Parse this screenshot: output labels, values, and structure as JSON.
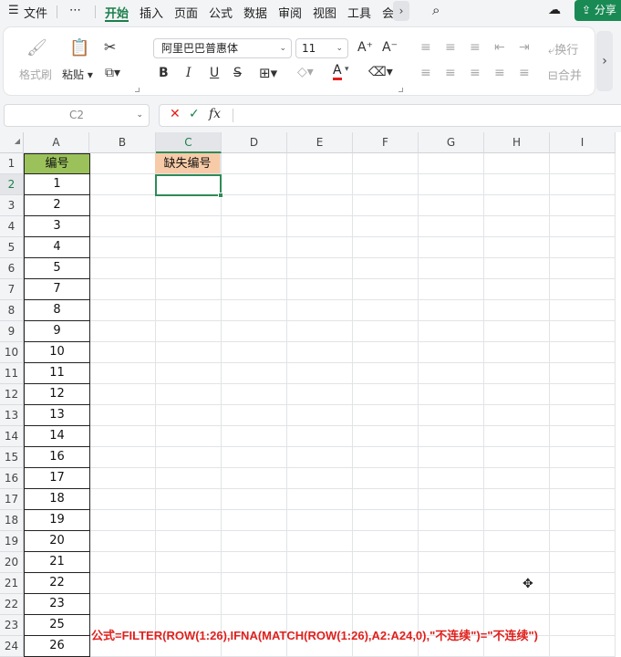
{
  "menu": {
    "file_icon": "hamburger-icon",
    "file": "文件",
    "more": "⋯",
    "tabs": [
      "开始",
      "插入",
      "页面",
      "公式",
      "数据",
      "审阅",
      "视图",
      "工具",
      "会"
    ],
    "active_tab": "开始",
    "share": "分享"
  },
  "ribbon": {
    "format_painter": "格式刷",
    "paste": "粘贴",
    "font_name": "阿里巴巴普惠体",
    "font_size": "11",
    "increase_font": "A⁺",
    "decrease_font": "A⁻",
    "bold": "B",
    "italic": "I",
    "underline": "U",
    "wrap": "换行",
    "merge": "合并"
  },
  "formula_bar": {
    "cell_ref": "C2",
    "cancel": "✕",
    "confirm": "✓",
    "fx": "fx",
    "content": ""
  },
  "columns": [
    "A",
    "B",
    "C",
    "D",
    "E",
    "F",
    "G",
    "H",
    "I"
  ],
  "rows": [
    "1",
    "2",
    "3",
    "4",
    "5",
    "6",
    "7",
    "8",
    "9",
    "10",
    "11",
    "12",
    "13",
    "14",
    "15",
    "16",
    "17",
    "18",
    "19",
    "20",
    "21",
    "22",
    "23",
    "24"
  ],
  "sheet": {
    "a_header": "编号",
    "a_values": [
      "1",
      "2",
      "3",
      "4",
      "5",
      "7",
      "8",
      "9",
      "10",
      "11",
      "12",
      "13",
      "14",
      "16",
      "17",
      "18",
      "19",
      "20",
      "21",
      "22",
      "23",
      "25",
      "26"
    ],
    "c_header": "缺失编号",
    "selected_cell": "C2"
  },
  "annotation": "公式=FILTER(ROW(1:26),IFNA(MATCH(ROW(1:26),A2:A24,0),\"不连续\")=\"不连续\")",
  "colors": {
    "accent": "#1a7f4b",
    "header_a_fill": "#9ac15a",
    "header_c_fill": "#f8cba8",
    "annotation_text": "#e0201c"
  }
}
